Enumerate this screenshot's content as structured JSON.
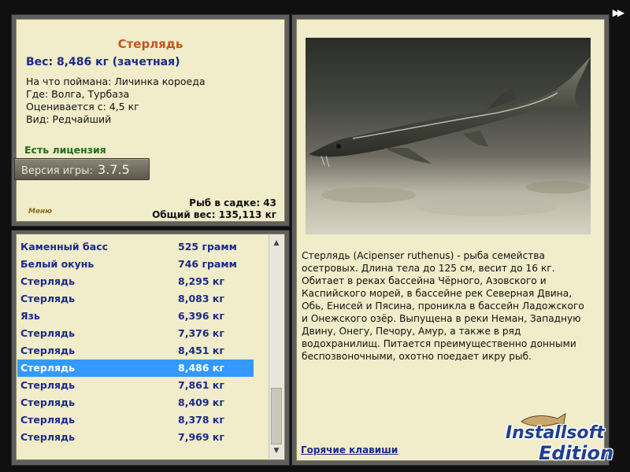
{
  "info": {
    "fish_name": "Стерлядь",
    "weight": "Вес: 8,486 кг (зачетная)",
    "bait": "На что поймана: Личинка короеда",
    "location": "Где: Волга, Турбаза",
    "valued_from": "Оценивается с: 4,5 кг",
    "type": "Вид: Редчайший",
    "license": "Есть лицензия",
    "version_label": "Версия игры:",
    "version_number": "3.7.5",
    "menu_label": "Меню",
    "fish_in_net": "Рыб в садке: 43",
    "total_weight": "Общий вес: 135,113 кг"
  },
  "catch_list": [
    {
      "name": "Каменный басс",
      "weight": "525 грамм"
    },
    {
      "name": "Белый окунь",
      "weight": "746 грамм"
    },
    {
      "name": "Стерлядь",
      "weight": "8,295 кг"
    },
    {
      "name": "Стерлядь",
      "weight": "8,083 кг"
    },
    {
      "name": "Язь",
      "weight": "6,396 кг"
    },
    {
      "name": "Стерлядь",
      "weight": "7,376 кг"
    },
    {
      "name": "Стерлядь",
      "weight": "8,451 кг"
    },
    {
      "name": "Стерлядь",
      "weight": "8,486 кг"
    },
    {
      "name": "Стерлядь",
      "weight": "7,861 кг"
    },
    {
      "name": "Стерлядь",
      "weight": "8,409 кг"
    },
    {
      "name": "Стерлядь",
      "weight": "8,378 кг"
    },
    {
      "name": "Стерлядь",
      "weight": "7,969 кг"
    }
  ],
  "selected_index": 7,
  "description": "Стерлядь (Acipenser ruthenus) - рыба семейства осетровых. Длина тела до 125 см, весит до 16 кг. Обитает в реках бассейна Чёрного, Азовского и Каспийского морей, в бассейне рек Северная Двина, Обь, Енисей и Пясина, проникла в бассейн Ладожского и Онежского озёр. Выпущена в реки Неман, Западную Двину, Онегу, Печору, Амур, а также в ряд водохранилищ. Питается преимущественно донными беспозвоночными, охотно поедает икру рыб.",
  "hotkeys_label": "Горячие клавиши",
  "watermark": {
    "line1": "Installsoft",
    "line2": "Edition"
  },
  "icons": {
    "fast_forward": "fast-forward-icon",
    "scroll_up": "scroll-up-icon",
    "scroll_down": "scroll-down-icon",
    "fish_photo": "sterlet-photo"
  },
  "colors": {
    "panel_bg": "#f1ecc9",
    "title": "#c2571f",
    "list_text": "#1a2a8a",
    "selected_row": "#3399ff",
    "license": "#1f6e1f"
  }
}
